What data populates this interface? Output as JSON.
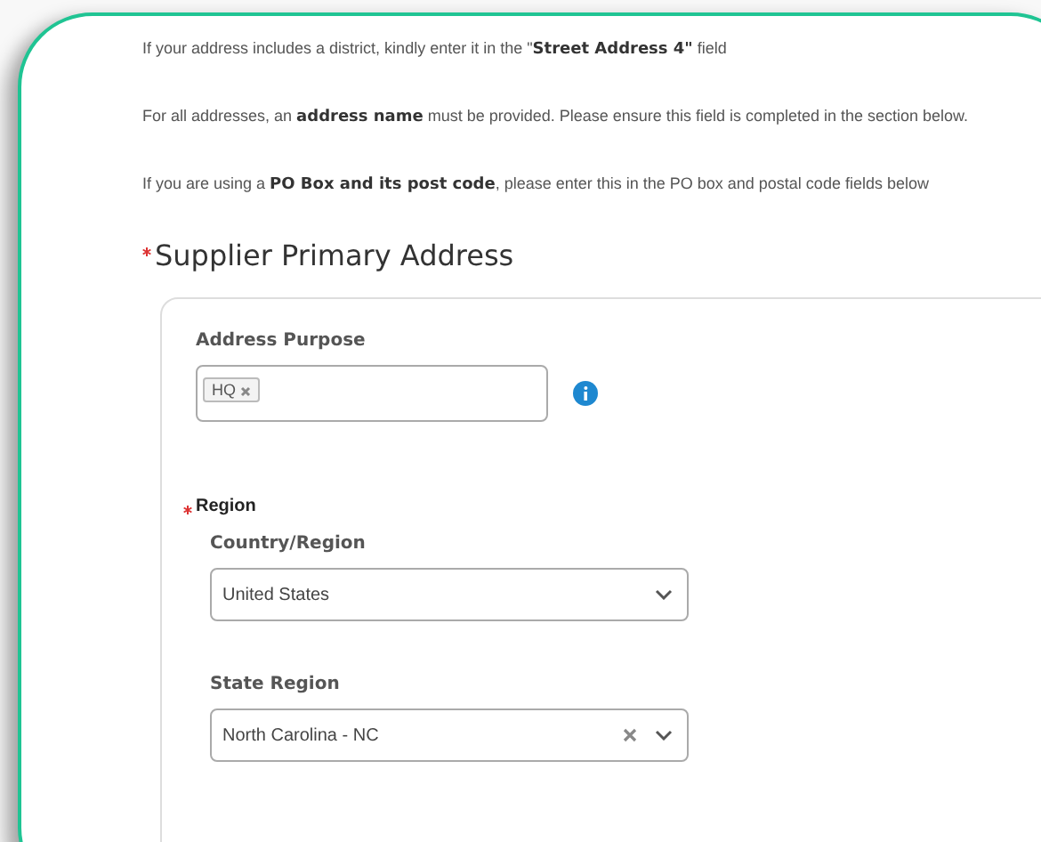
{
  "notes": [
    "If your address includes a district, kindly enter it in the \"**Street Address 4\"** field",
    "For all addresses, an **address name** must be provided. Please ensure this field is completed in the section below.",
    "If you are using a **PO Box and its post code**, please enter this in the PO box and postal code fields below"
  ],
  "section": {
    "title": "Supplier Primary Address",
    "required": true,
    "address_purpose": {
      "label": "Address Purpose",
      "tags": [
        "HQ"
      ]
    },
    "region": {
      "title": "Region",
      "required": true,
      "fields": [
        {
          "label": "Country/Region",
          "value": "United States",
          "clearable": false
        },
        {
          "label": "State Region",
          "value": "North Carolina - NC",
          "clearable": true
        }
      ]
    }
  }
}
